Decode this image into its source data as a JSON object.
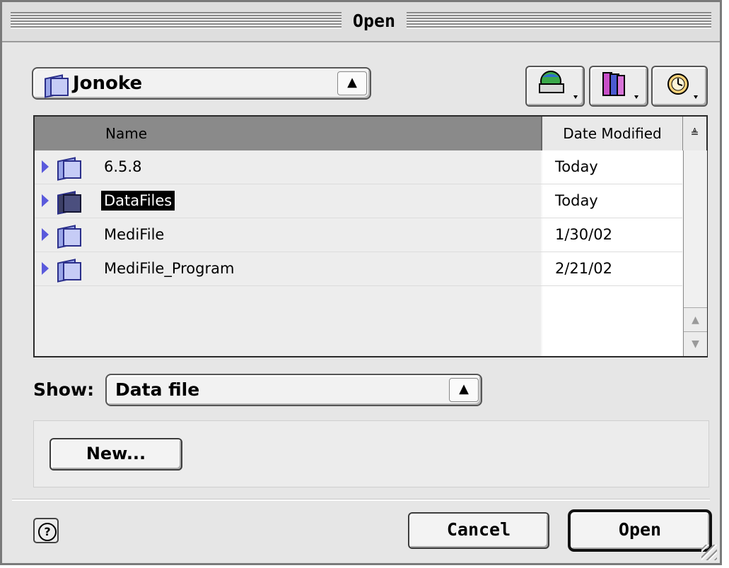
{
  "window": {
    "title": "Open"
  },
  "location_popup": {
    "label": "Jonoke"
  },
  "toolbar": {
    "buttons": [
      {
        "name": "shortcuts-icon"
      },
      {
        "name": "favorites-icon"
      },
      {
        "name": "recent-icon"
      }
    ]
  },
  "file_list": {
    "columns": {
      "name": "Name",
      "date": "Date Modified",
      "sort_indicator": "≜"
    },
    "rows": [
      {
        "name": "6.5.8",
        "date": "Today",
        "selected": false
      },
      {
        "name": "DataFiles",
        "date": "Today",
        "selected": true
      },
      {
        "name": "MediFile",
        "date": "1/30/02",
        "selected": false
      },
      {
        "name": "MediFile_Program",
        "date": "2/21/02",
        "selected": false
      }
    ]
  },
  "show": {
    "label": "Show:",
    "value": "Data file"
  },
  "new_button": {
    "label": "New..."
  },
  "footer": {
    "cancel_label": "Cancel",
    "open_label": "Open",
    "help_glyph": "?"
  },
  "colors": {
    "header_selected": "#8a8a8a",
    "selection": "#000000",
    "folder": "#c6ccf6"
  }
}
